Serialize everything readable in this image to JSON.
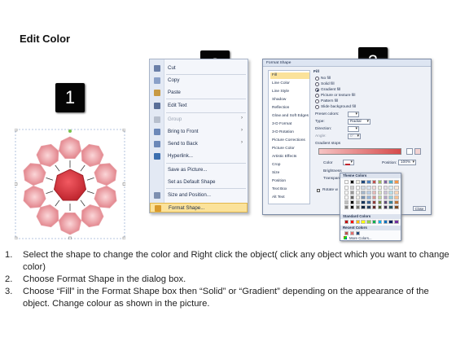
{
  "title": "Edit Color",
  "badges": [
    "1",
    "2",
    "3"
  ],
  "context_menu": {
    "items": [
      {
        "label": "Cut",
        "icon": "scissors-icon",
        "color": "#6a7fa8",
        "enabled": true,
        "submenu": false
      },
      {
        "label": "Copy",
        "icon": "copy-icon",
        "color": "#8aa0c8",
        "enabled": true,
        "submenu": false
      },
      {
        "label": "Paste",
        "icon": "paste-icon",
        "color": "#c89a44",
        "enabled": true,
        "submenu": false
      },
      {
        "label": "Edit Text",
        "icon": "edit-text-icon",
        "color": "#5a6f98",
        "enabled": true,
        "submenu": false
      },
      {
        "label": "Group",
        "icon": "group-icon",
        "color": "#b7bfcd",
        "enabled": false,
        "submenu": true
      },
      {
        "label": "Bring to Front",
        "icon": "bring-front-icon",
        "color": "#6c88b8",
        "enabled": true,
        "submenu": true
      },
      {
        "label": "Send to Back",
        "icon": "send-back-icon",
        "color": "#6c88b8",
        "enabled": true,
        "submenu": true
      },
      {
        "label": "Hyperlink...",
        "icon": "hyperlink-icon",
        "color": "#3c6fb0",
        "enabled": true,
        "submenu": false
      },
      {
        "label": "Save as Picture...",
        "icon": "",
        "color": "",
        "enabled": true,
        "submenu": false
      },
      {
        "label": "Set as Default Shape",
        "icon": "",
        "color": "",
        "enabled": true,
        "submenu": false
      },
      {
        "label": "Size and Position...",
        "icon": "size-icon",
        "color": "#7d8fb0",
        "enabled": true,
        "submenu": false
      },
      {
        "label": "Format Shape...",
        "icon": "format-shape-icon",
        "color": "#d99a2c",
        "enabled": true,
        "submenu": false,
        "highlighted": true
      }
    ]
  },
  "format_dialog": {
    "title": "Format Shape",
    "categories": [
      "Fill",
      "Line Color",
      "Line Style",
      "Shadow",
      "Reflection",
      "Glow and Soft Edges",
      "3-D Format",
      "3-D Rotation",
      "Picture Corrections",
      "Picture Color",
      "Artistic Effects",
      "Crop",
      "Size",
      "Position",
      "Text Box",
      "Alt Text"
    ],
    "selected_category": "Fill",
    "pane_title": "Fill",
    "fill_options": [
      {
        "label": "No fill",
        "selected": false
      },
      {
        "label": "Solid fill",
        "selected": false
      },
      {
        "label": "Gradient fill",
        "selected": true
      },
      {
        "label": "Picture or texture fill",
        "selected": false
      },
      {
        "label": "Pattern fill",
        "selected": false
      },
      {
        "label": "Slide background fill",
        "selected": false
      }
    ],
    "preset_colors_label": "Preset colors:",
    "type_label": "Type:",
    "type_value": "Radial",
    "direction_label": "Direction:",
    "angle_label": "Angle:",
    "angle_value": "0°",
    "gradient_stops_label": "Gradient stops",
    "color_label": "Color",
    "position_label": "Position:",
    "position_value": "100%",
    "brightness_label": "Brightness",
    "transparency_label": "Transparency",
    "rotate_label": "Rotate w",
    "close_label": "Close"
  },
  "palette": {
    "theme_label": "Theme Colors",
    "standard_label": "Standard Colors",
    "recent_label": "Recent Colors",
    "more_label": "More Colors...",
    "theme_colors": [
      "#ffffff",
      "#000000",
      "#eeece1",
      "#1f497d",
      "#4f81bd",
      "#c0504d",
      "#9bbb59",
      "#8064a2",
      "#4bacc6",
      "#f79646"
    ],
    "standard_colors": [
      "#c00000",
      "#ff0000",
      "#ffc000",
      "#ffff00",
      "#92d050",
      "#00b050",
      "#00b0f0",
      "#0070c0",
      "#002060",
      "#7030a0"
    ],
    "recent_colors": [
      "#c0504d",
      "#e46c6c",
      "#1f497d"
    ]
  },
  "instructions": [
    {
      "num": "1.",
      "text": "Select the shape to change the color and Right click the object( click any object which you want to change color)"
    },
    {
      "num": "2.",
      "text": "Choose Format Shape in the dialog box."
    },
    {
      "num": "3.",
      "text": "Choose “Fill” in the Format Shape box then “Solid” or “Gradient” depending on the appearance of the object. Change colour as shown in the picture."
    }
  ]
}
